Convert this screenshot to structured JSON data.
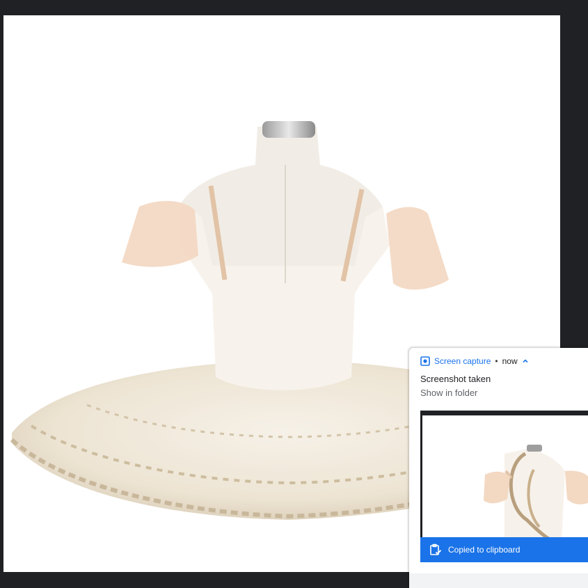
{
  "notification": {
    "app_icon": "screen-capture-icon",
    "app_name": "Screen capture",
    "separator": "•",
    "time": "now",
    "expand_icon": "chevron-up-icon",
    "title": "Screenshot taken",
    "action_label": "Show in folder",
    "copied_icon": "clipboard-check-icon",
    "copied_label": "Copied to clipboard"
  },
  "colors": {
    "desktop": "#202124",
    "accent": "#1a73e8",
    "text_primary": "#202124",
    "text_secondary": "#5f6368"
  }
}
